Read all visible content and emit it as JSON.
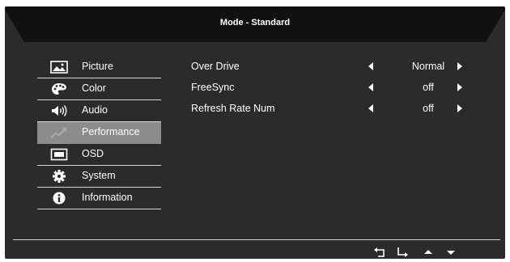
{
  "title": "Mode - Standard",
  "menu": [
    {
      "label": "Picture",
      "icon": "picture-icon",
      "active": false
    },
    {
      "label": "Color",
      "icon": "palette-icon",
      "active": false
    },
    {
      "label": "Audio",
      "icon": "speaker-icon",
      "active": false
    },
    {
      "label": "Performance",
      "icon": "trend-up-icon",
      "active": true
    },
    {
      "label": "OSD",
      "icon": "osd-screen-icon",
      "active": false
    },
    {
      "label": "System",
      "icon": "gear-icon",
      "active": false
    },
    {
      "label": "Information",
      "icon": "info-icon",
      "active": false
    }
  ],
  "settings": [
    {
      "name": "Over Drive",
      "value": "Normal"
    },
    {
      "name": "FreeSync",
      "value": "off"
    },
    {
      "name": "Refresh Rate Num",
      "value": "off"
    }
  ],
  "navigation": [
    "back-icon",
    "enter-icon",
    "up-icon",
    "down-icon"
  ],
  "colors": {
    "panel": "#2b2b2b",
    "header": "#111111",
    "selected": "#8c8c8c",
    "text": "#ffffff",
    "line": "#d8d8d8"
  }
}
